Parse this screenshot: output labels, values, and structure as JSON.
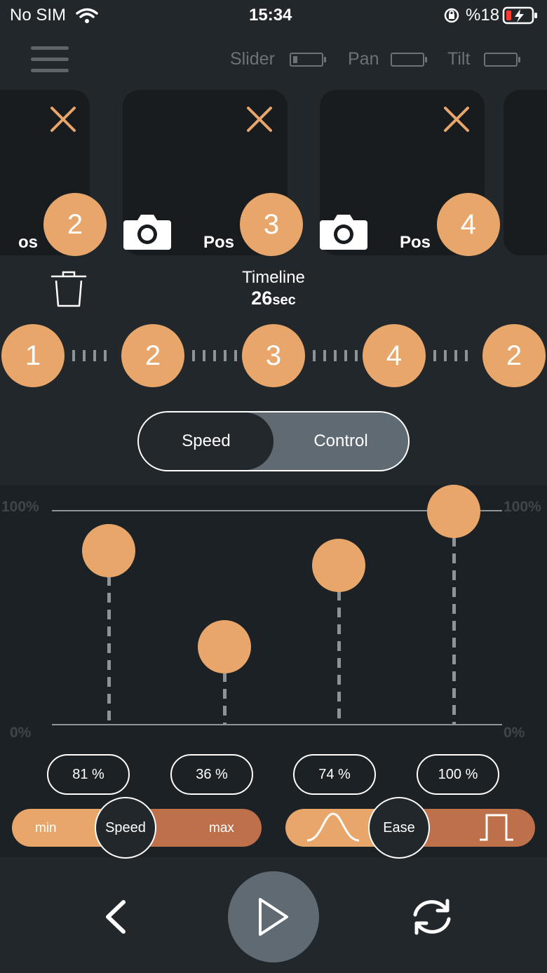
{
  "status": {
    "carrier": "No SIM",
    "time": "15:34",
    "battery": "%18"
  },
  "header": {
    "slider_label": "Slider",
    "pan_label": "Pan",
    "tilt_label": "Tilt"
  },
  "cards": [
    {
      "pos_label": "os",
      "number": "2"
    },
    {
      "pos_label": "Pos",
      "number": "3"
    },
    {
      "pos_label": "Pos",
      "number": "4"
    }
  ],
  "timeline": {
    "title": "Timeline",
    "value": "26",
    "unit": "sec",
    "nodes": [
      "1",
      "2",
      "3",
      "4",
      "2"
    ]
  },
  "toggle": {
    "left": "Speed",
    "right": "Control",
    "active": "Speed"
  },
  "chart": {
    "top_left": "100%",
    "top_right": "100%",
    "bottom_left": "0%",
    "bottom_right": "0%"
  },
  "chart_data": {
    "type": "scatter",
    "title": "",
    "xlabel": "",
    "ylabel": "",
    "ylim": [
      0,
      100
    ],
    "x": [
      1,
      2,
      3,
      4
    ],
    "values": [
      81,
      36,
      74,
      100
    ],
    "labels": [
      "81 %",
      "36 %",
      "74 %",
      "100 %"
    ]
  },
  "sliders": {
    "speed": {
      "min": "min",
      "max": "max",
      "knob": "Speed"
    },
    "ease": {
      "knob": "Ease"
    }
  },
  "colors": {
    "accent": "#e8a66b",
    "accent_dark": "#be704b",
    "background": "#22272b"
  }
}
